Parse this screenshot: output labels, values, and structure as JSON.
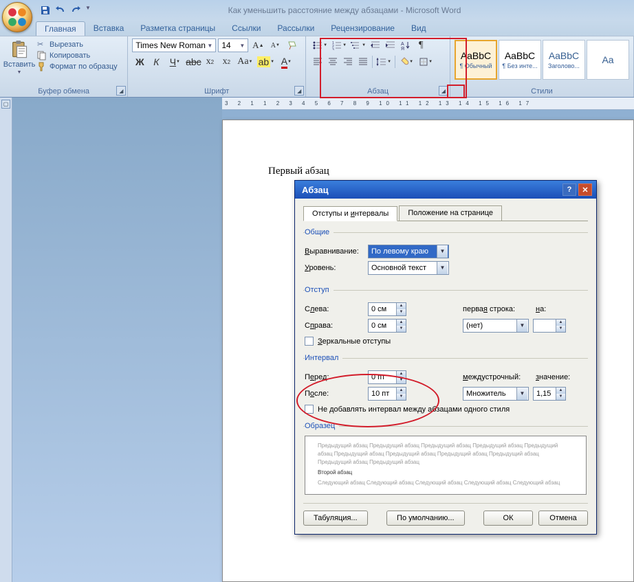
{
  "window": {
    "title": "Как уменьшить расстояние между абзацами - Microsoft Word"
  },
  "qat": {
    "save": "save",
    "undo": "undo",
    "redo": "redo"
  },
  "tabs": [
    "Главная",
    "Вставка",
    "Разметка страницы",
    "Ссылки",
    "Рассылки",
    "Рецензирование",
    "Вид"
  ],
  "clipboard": {
    "paste": "Вставить",
    "cut": "Вырезать",
    "copy": "Копировать",
    "format": "Формат по образцу",
    "group": "Буфер обмена"
  },
  "font": {
    "name": "Times New Roman",
    "size": "14",
    "group": "Шрифт"
  },
  "paragraph": {
    "group": "Абзац"
  },
  "styles": {
    "group": "Стили",
    "items": [
      {
        "preview": "AaBbC",
        "name": "¶ Обычный"
      },
      {
        "preview": "AaBbC",
        "name": "¶ Без инте..."
      },
      {
        "preview": "AaBbC",
        "name": "Заголово..."
      },
      {
        "preview": "Aa",
        "name": ""
      }
    ]
  },
  "doc": {
    "p1": "Первый абзац"
  },
  "ruler": "3  2  1     1  2  3  4  5  6  7  8  9  10  11  12  13  14  15  16  17",
  "dialog": {
    "title": "Абзац",
    "tabs": [
      "Отступы и интервалы",
      "Положение на странице"
    ],
    "general": {
      "legend": "Общие",
      "align_label": "Выравнивание:",
      "align_value": "По левому краю",
      "level_label": "Уровень:",
      "level_value": "Основной текст"
    },
    "indent": {
      "legend": "Отступ",
      "left_label": "Слева:",
      "left_value": "0 см",
      "right_label": "Справа:",
      "right_value": "0 см",
      "first_label": "первая строка:",
      "first_value": "(нет)",
      "by_label": "на:",
      "by_value": "",
      "mirror": "Зеркальные отступы"
    },
    "spacing": {
      "legend": "Интервал",
      "before_label": "Перед:",
      "before_value": "0 пт",
      "after_label": "После:",
      "after_value": "10 пт",
      "line_label": "междустрочный:",
      "line_value": "Множитель",
      "at_label": "значение:",
      "at_value": "1,15",
      "nosame": "Не добавлять интервал между абзацами одного стиля"
    },
    "sample": {
      "legend": "Образец",
      "prev": "Предыдущий абзац Предыдущий абзац Предыдущий абзац Предыдущий абзац Предыдущий абзац Предыдущий абзац Предыдущий абзац Предыдущий абзац Предыдущий абзац Предыдущий абзац Предыдущий абзац",
      "cur": "Второй абзац",
      "next": "Следующий абзац Следующий абзац Следующий абзац Следующий абзац Следующий абзац"
    },
    "buttons": {
      "tabs": "Табуляция...",
      "default": "По умолчанию...",
      "ok": "ОК",
      "cancel": "Отмена"
    }
  }
}
